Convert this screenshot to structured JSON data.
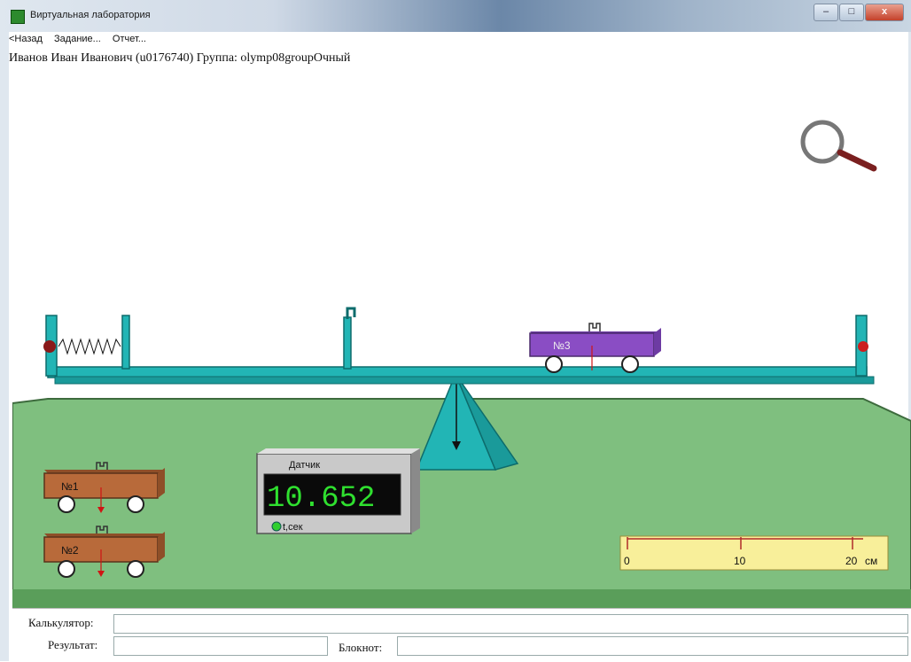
{
  "window": {
    "title": "Виртуальная лаборатория",
    "minimize": "–",
    "maximize": "□",
    "close": "x"
  },
  "menu": {
    "back": "<Назад",
    "task": "Задание...",
    "report": "Отчет..."
  },
  "user_line": "Иванов Иван Иванович (u0176740)  Группа: olymp08groupОчный",
  "carts": {
    "cart1": "№1",
    "cart2": "№2",
    "cart3": "№3"
  },
  "sensor": {
    "label": "Датчик",
    "value": "10.652",
    "indicator": "t,сек"
  },
  "ruler": {
    "ticks": [
      "0",
      "10",
      "20"
    ],
    "unit": "см"
  },
  "bottom": {
    "calculator_label": "Калькулятор:",
    "result_label": "Результат:",
    "notepad_label": "Блокнот:"
  },
  "icons": {
    "zoom": "magnifier-icon"
  },
  "colors": {
    "beam": "#22b5b5",
    "floor": "#7fbf7f",
    "cart_wood": "#b86a3a",
    "cart_purple": "#8a4dc4",
    "display_digits": "#2fe02f",
    "ruler": "#f8ef9a"
  }
}
